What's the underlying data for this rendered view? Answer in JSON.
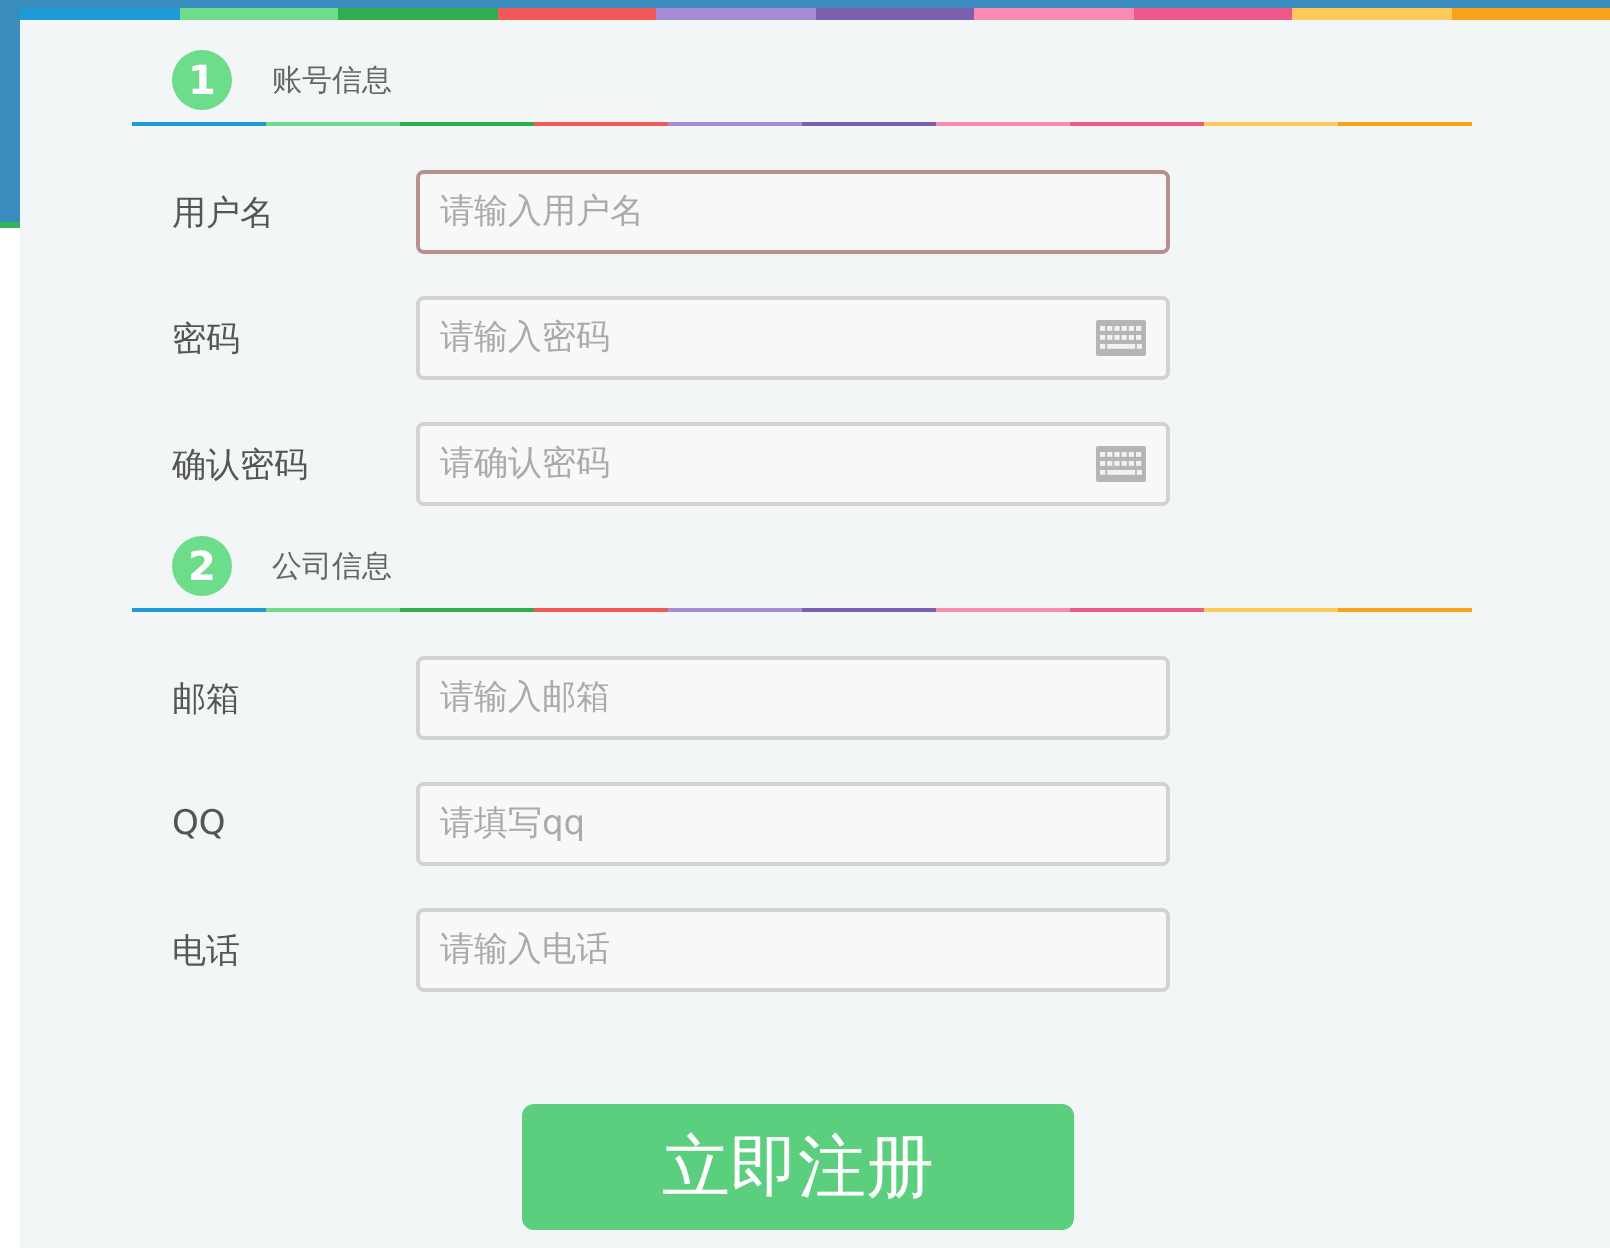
{
  "sections": [
    {
      "number": "1",
      "title": "账号信息",
      "fields": [
        {
          "label": "用户名",
          "placeholder": "请输入用户名",
          "focused": true,
          "keyboard": false
        },
        {
          "label": "密码",
          "placeholder": "请输入密码",
          "focused": false,
          "keyboard": true
        },
        {
          "label": "确认密码",
          "placeholder": "请确认密码",
          "focused": false,
          "keyboard": true
        }
      ]
    },
    {
      "number": "2",
      "title": "公司信息",
      "fields": [
        {
          "label": "邮箱",
          "placeholder": "请输入邮箱",
          "focused": false,
          "keyboard": false
        },
        {
          "label": "QQ",
          "placeholder": "请填写qq",
          "focused": false,
          "keyboard": false
        },
        {
          "label": "电话",
          "placeholder": "请输入电话",
          "focused": false,
          "keyboard": false
        }
      ]
    }
  ],
  "submit": "立即注册"
}
